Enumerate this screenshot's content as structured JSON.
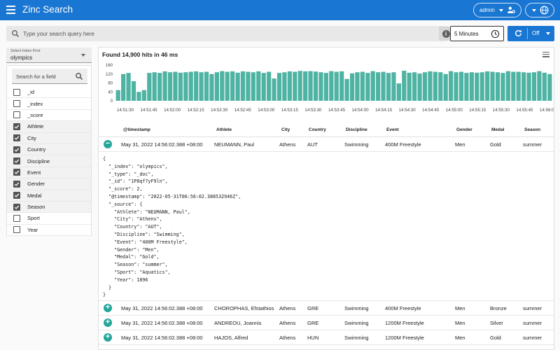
{
  "app": {
    "title": "Zinc Search"
  },
  "header": {
    "user_label": "admin",
    "icons": [
      "menu-icon",
      "admin-settings-icon",
      "globe-icon",
      "chevron-down-icon"
    ]
  },
  "search": {
    "placeholder": "Type your search query here",
    "value": ""
  },
  "time_range": {
    "label": "5 Minutes"
  },
  "refresh": {
    "label": "Off"
  },
  "colors": {
    "primary": "#1976d2",
    "bar": "#4fb3a3",
    "toggle": "#26a69a"
  },
  "index_select": {
    "label": "Select Index First",
    "value": "olympics"
  },
  "field_search": {
    "placeholder": "Search for a field"
  },
  "fields": [
    {
      "name": "_id",
      "checked": false
    },
    {
      "name": "_index",
      "checked": false
    },
    {
      "name": "_score",
      "checked": false
    },
    {
      "name": "Athlete",
      "checked": true
    },
    {
      "name": "City",
      "checked": true
    },
    {
      "name": "Country",
      "checked": true
    },
    {
      "name": "Discipline",
      "checked": true
    },
    {
      "name": "Event",
      "checked": true
    },
    {
      "name": "Gender",
      "checked": true
    },
    {
      "name": "Medal",
      "checked": true
    },
    {
      "name": "Season",
      "checked": true
    },
    {
      "name": "Sport",
      "checked": false
    },
    {
      "name": "Year",
      "checked": false
    }
  ],
  "results": {
    "summary": "Found 14,900 hits in 46 ms"
  },
  "chart_data": {
    "type": "bar",
    "title": "",
    "ylim": [
      0,
      160
    ],
    "yticks": [
      "160",
      "120",
      "80",
      "40",
      "0"
    ],
    "xticks": [
      "14:51:30",
      "14:51:45",
      "14:52:00",
      "14:52:15",
      "14:52:30",
      "14:52:45",
      "14:53:00",
      "14:53:15",
      "14:53:30",
      "14:53:45",
      "14:54:00",
      "14:54:15",
      "14:54:30",
      "14:54:45",
      "14:55:00",
      "14:55:15",
      "14:55:30",
      "14:55:45",
      "14:56:00"
    ],
    "values": [
      48,
      120,
      125,
      88,
      40,
      48,
      125,
      128,
      125,
      132,
      128,
      130,
      126,
      128,
      130,
      132,
      128,
      130,
      120,
      128,
      133,
      130,
      132,
      126,
      132,
      130,
      128,
      132,
      125,
      130,
      100,
      125,
      128,
      132,
      130,
      134,
      132,
      133,
      131,
      128,
      125,
      133,
      130,
      132,
      98,
      123,
      128,
      130,
      125,
      133,
      128,
      130,
      125,
      128,
      78,
      135,
      126,
      128,
      122,
      128,
      132,
      130,
      128,
      120,
      133,
      128,
      130,
      125,
      128,
      126,
      128,
      132,
      130,
      128,
      125,
      133,
      130,
      130,
      128,
      126,
      128,
      133,
      126,
      120
    ]
  },
  "table": {
    "columns": [
      "@timestamp",
      "Athlete",
      "City",
      "Country",
      "Discipline",
      "Event",
      "Gender",
      "Medal",
      "Season"
    ],
    "rows": [
      {
        "expanded": true,
        "timestamp": "May 31, 2022 14:56:02.388 +08:00",
        "athlete": "NEUMANN, Paul",
        "city": "Athens",
        "country": "AUT",
        "discipline": "Swimming",
        "event": "400M Freestyle",
        "gender": "Men",
        "medal": "Gold",
        "season": "summer"
      },
      {
        "expanded": false,
        "timestamp": "May 31, 2022 14:56:02.388 +08:00",
        "athlete": "CHOROPHAS, Efstathios",
        "city": "Athens",
        "country": "GRE",
        "discipline": "Swimming",
        "event": "400M Freestyle",
        "gender": "Men",
        "medal": "Bronze",
        "season": "summer"
      },
      {
        "expanded": false,
        "timestamp": "May 31, 2022 14:56:02.388 +08:00",
        "athlete": "ANDREOU, Joannis",
        "city": "Athens",
        "country": "GRE",
        "discipline": "Swimming",
        "event": "1200M Freestyle",
        "gender": "Men",
        "medal": "Silver",
        "season": "summer"
      },
      {
        "expanded": false,
        "timestamp": "May 31, 2022 14:56:02.388 +08:00",
        "athlete": "HAJOS, Alfred",
        "city": "Athens",
        "country": "HUN",
        "discipline": "Swimming",
        "event": "1200M Freestyle",
        "gender": "Men",
        "medal": "Gold",
        "season": "summer"
      }
    ],
    "expanded_json": "{\n  \"_index\": \"olympics\",\n  \"_type\": \"_doc\",\n  \"_id\": \"1P8qf7yF9ln\",\n  \"_score\": 2,\n  \"@timestamp\": \"2022-05-31T06:56:02.388532946Z\",\n  \"_source\": {\n    \"Athlete\": \"NEUMANN, Paul\",\n    \"City\": \"Athens\",\n    \"Country\": \"AUT\",\n    \"Discipline\": \"Swimming\",\n    \"Event\": \"400M Freestyle\",\n    \"Gender\": \"Men\",\n    \"Medal\": \"Gold\",\n    \"Season\": \"summer\",\n    \"Sport\": \"Aquatics\",\n    \"Year\": 1896\n  }\n}"
  }
}
